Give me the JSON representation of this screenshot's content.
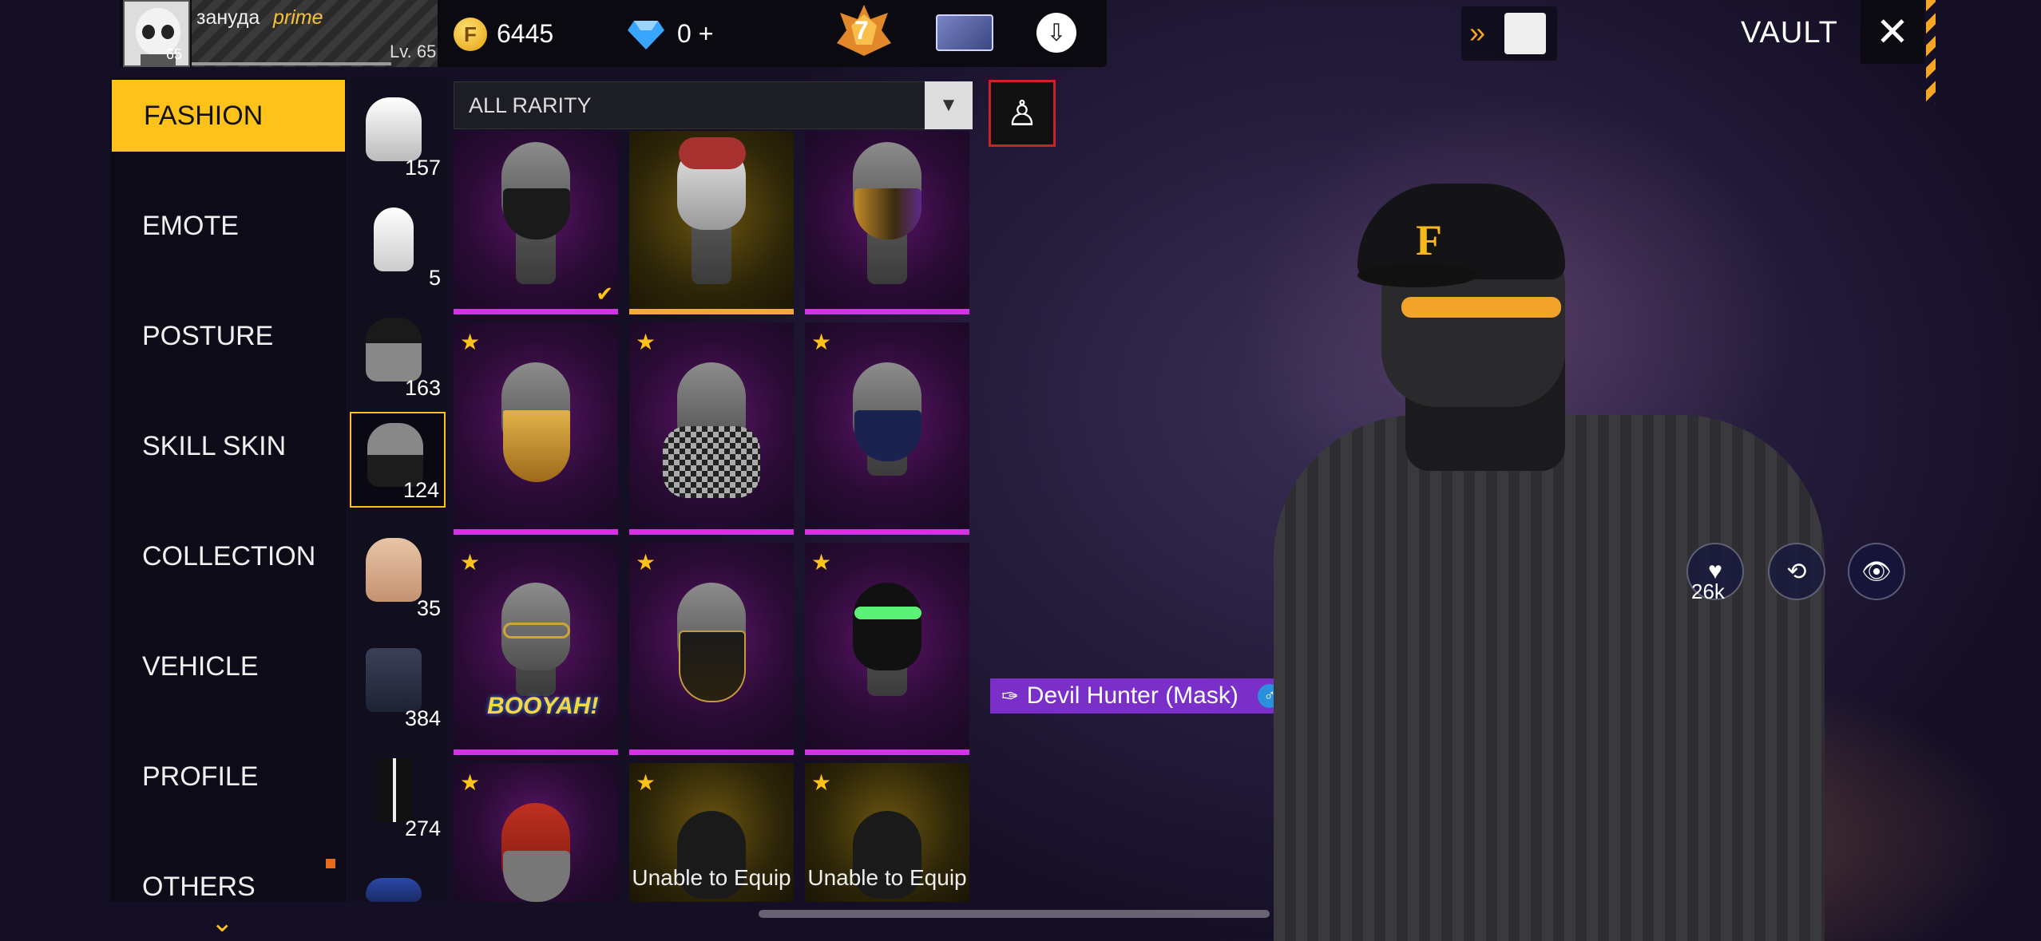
{
  "player": {
    "name": "зануда",
    "tag": "prime",
    "level": "Lv. 65",
    "avatar_level": "65"
  },
  "currency": {
    "gold": "6445",
    "diamonds": "0 +"
  },
  "rank": "7",
  "header": {
    "title": "VAULT"
  },
  "menu": [
    {
      "label": "FASHION",
      "active": true
    },
    {
      "label": "EMOTE"
    },
    {
      "label": "POSTURE"
    },
    {
      "label": "SKILL SKIN"
    },
    {
      "label": "COLLECTION"
    },
    {
      "label": "VEHICLE"
    },
    {
      "label": "PROFILE"
    },
    {
      "label": "OTHERS"
    }
  ],
  "subcategories": [
    {
      "name": "full-outfit",
      "count": "157"
    },
    {
      "name": "jumpsuit",
      "count": "5"
    },
    {
      "name": "headwear",
      "count": "163"
    },
    {
      "name": "mask",
      "count": "124",
      "active": true
    },
    {
      "name": "face",
      "count": "35"
    },
    {
      "name": "top",
      "count": "384"
    },
    {
      "name": "bottom",
      "count": "274"
    }
  ],
  "filter": {
    "label": "ALL RARITY"
  },
  "items": [
    {
      "name": "black-pattern-mask",
      "rarity": "purple",
      "caption": ""
    },
    {
      "name": "clown-mask",
      "rarity": "gold",
      "caption": ""
    },
    {
      "name": "gold-purple-mask",
      "rarity": "purple",
      "caption": ""
    },
    {
      "name": "gold-bandana",
      "rarity": "purple",
      "caption": ""
    },
    {
      "name": "checkered-scarf",
      "rarity": "purple",
      "caption": ""
    },
    {
      "name": "blue-mask",
      "rarity": "purple",
      "caption": ""
    },
    {
      "name": "booyah-glasses",
      "rarity": "purple",
      "caption": ""
    },
    {
      "name": "gold-black-mask",
      "rarity": "purple",
      "caption": ""
    },
    {
      "name": "green-visor-mask",
      "rarity": "purple",
      "caption": ""
    },
    {
      "name": "red-hair-mask",
      "rarity": "purple",
      "caption": ""
    },
    {
      "name": "locked-mask-1",
      "rarity": "gold",
      "caption": "Unable to Equip"
    },
    {
      "name": "locked-mask-2",
      "rarity": "gold",
      "caption": "Unable to Equip"
    }
  ],
  "selected_item": {
    "name": "Devil Hunter (Mask)",
    "gender_icon": "male-icon"
  },
  "character": {
    "cap_logo": "F",
    "likes": "26k"
  },
  "colors": {
    "accent": "#ffc21a",
    "rarity_purple": "#d333e3",
    "rarity_gold": "#f1a93a",
    "tag_purple": "#7a2fc8"
  }
}
